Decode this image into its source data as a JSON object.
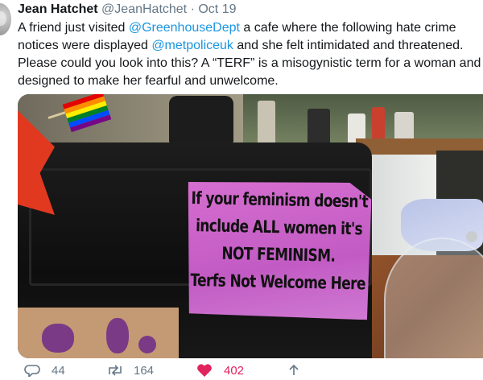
{
  "tweet": {
    "name": "Jean Hatchet",
    "handle": "@JeanHatchet",
    "separator": "·",
    "date": "Oct 19",
    "text_parts": {
      "p1": "A friend just visited ",
      "m1": "@GreenhouseDept",
      "p2": " a cafe where the following hate crime notices were displayed ",
      "m2": "@metpoliceuk",
      "p3": " and she felt intimidated and threatened. Please could you look into this? A “TERF” is a misogynistic term for a woman and designed to make her fearful and unwelcome."
    }
  },
  "photo": {
    "notice_lines": [
      "If your feminism doesn't",
      "include ALL women it's",
      "NOT FEMINISM.",
      "Terfs Not Welcome Here"
    ],
    "flag_colors": [
      "#e40303",
      "#ff8c00",
      "#ffed00",
      "#008026",
      "#004dff",
      "#750787"
    ]
  },
  "actions": {
    "reply_count": "44",
    "retweet_count": "164",
    "like_count": "402",
    "icons": [
      "reply-icon",
      "retweet-icon",
      "heart-icon",
      "share-icon"
    ]
  },
  "colors": {
    "link": "#1b95e0",
    "like": "#e0245e",
    "muted": "#657786"
  }
}
